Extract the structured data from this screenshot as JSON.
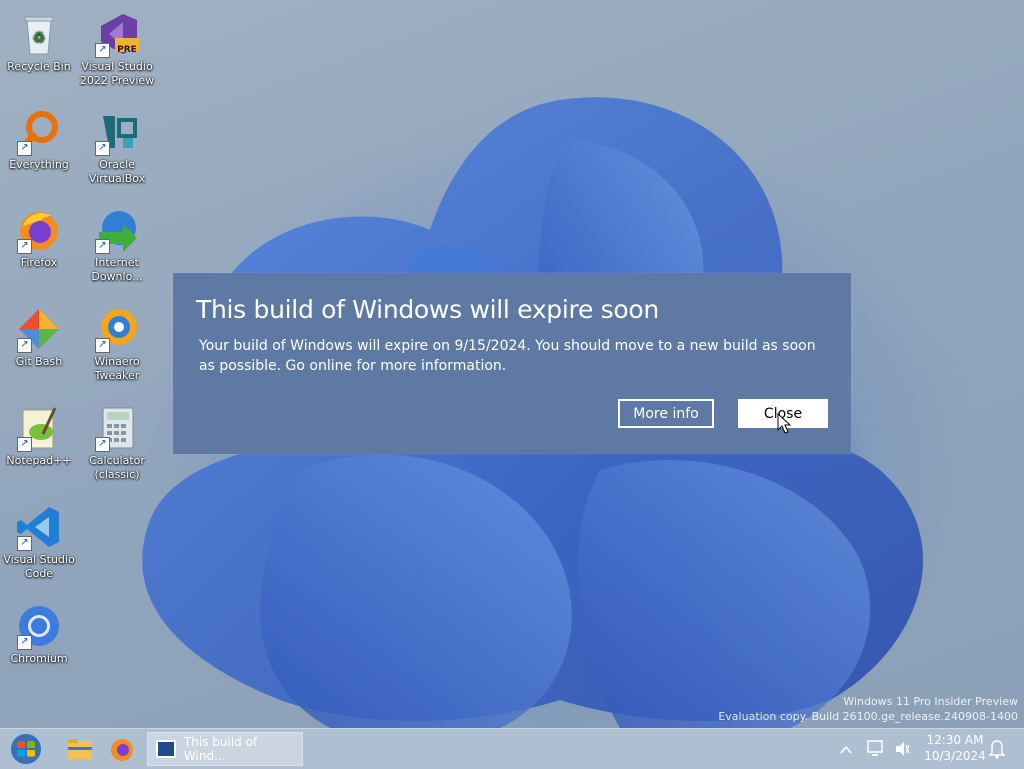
{
  "desktop_icons": [
    {
      "label": "Recycle Bin",
      "icon": "recycle-bin-icon"
    },
    {
      "label": "Visual Studio 2022 Preview",
      "icon": "visual-studio-preview-icon",
      "badge": "PRE"
    },
    {
      "label": "Everything",
      "icon": "everything-search-icon"
    },
    {
      "label": "Oracle VirtualBox",
      "icon": "virtualbox-icon"
    },
    {
      "label": "Firefox",
      "icon": "firefox-icon"
    },
    {
      "label": "Internet Downlo...",
      "icon": "internet-download-manager-icon"
    },
    {
      "label": "Git Bash",
      "icon": "git-bash-icon"
    },
    {
      "label": "Winaero Tweaker",
      "icon": "winaero-tweaker-icon"
    },
    {
      "label": "Notepad++",
      "icon": "notepad-plus-plus-icon"
    },
    {
      "label": "Calculator (classic)",
      "icon": "calculator-icon"
    },
    {
      "label": "Visual Studio Code",
      "icon": "vscode-icon"
    },
    {
      "label": "Chromium",
      "icon": "chromium-icon"
    }
  ],
  "dialog": {
    "title": "This build of Windows will expire soon",
    "message": "Your build of Windows will expire on 9/15/2024. You should move to a new build as soon as possible. Go online for more information.",
    "more_info_label": "More info",
    "close_label": "Close"
  },
  "watermark": {
    "line1": "Windows 11 Pro Insider Preview",
    "line2": "Evaluation copy. Build 26100.ge_release.240908-1400"
  },
  "taskbar": {
    "window_title": "This build of Wind...",
    "time": "12:30 AM",
    "date": "10/3/2024"
  },
  "colors": {
    "dialog_bg": "#5e79a3",
    "taskbar_bg": "#aebfd1",
    "wallpaper_accent": "#1858d8"
  }
}
